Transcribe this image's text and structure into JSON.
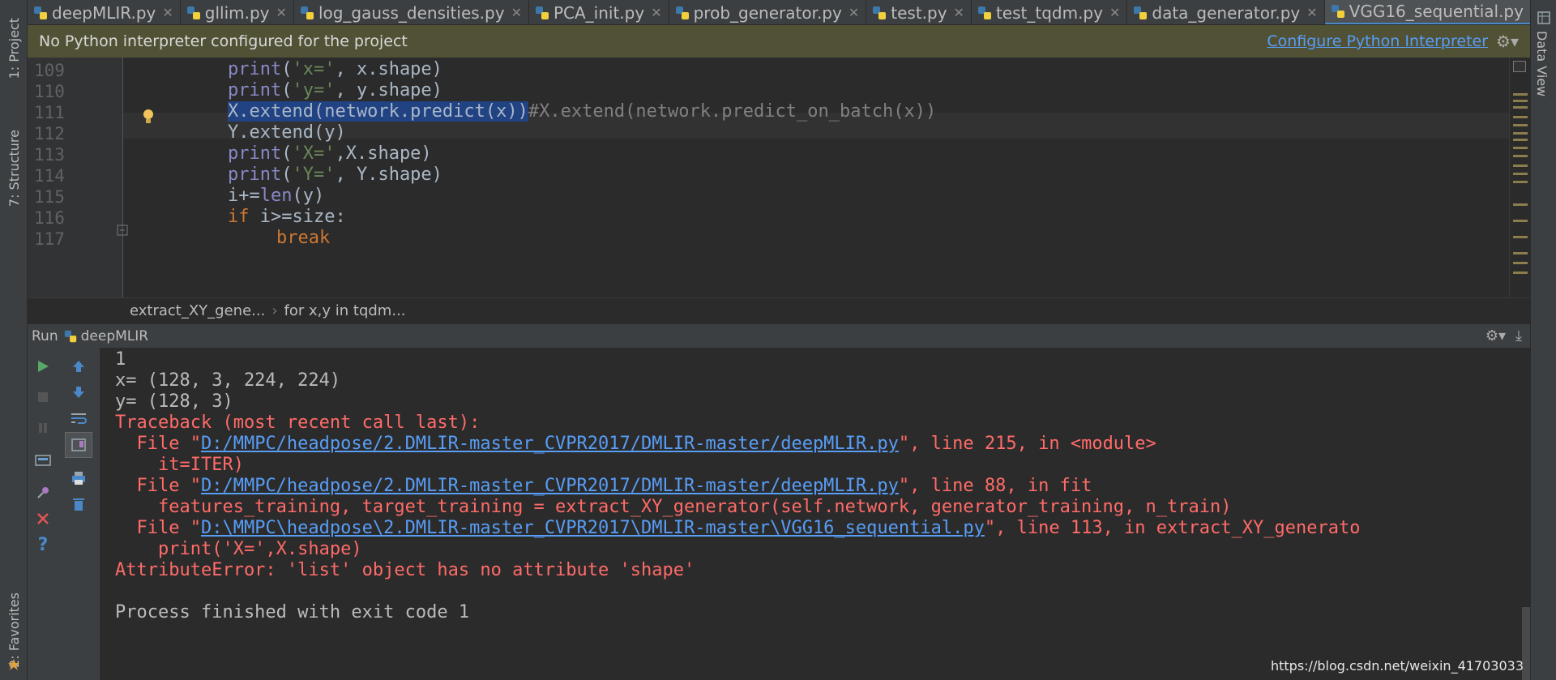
{
  "tabs": [
    {
      "label": "deepMLIR.py"
    },
    {
      "label": "gllim.py"
    },
    {
      "label": "log_gauss_densities.py"
    },
    {
      "label": "PCA_init.py"
    },
    {
      "label": "prob_generator.py"
    },
    {
      "label": "test.py"
    },
    {
      "label": "test_tqdm.py"
    },
    {
      "label": "data_generator.py"
    },
    {
      "label": "VGG16_sequential.py"
    }
  ],
  "side": {
    "project": "1: Project",
    "structure": "7: Structure",
    "favorites": "2: Favorites",
    "data_view": "Data View"
  },
  "notification": {
    "message": "No Python interpreter configured for the project",
    "link": "Configure Python Interpreter"
  },
  "editor": {
    "lines": [
      {
        "num": "109"
      },
      {
        "num": "110"
      },
      {
        "num": "111"
      },
      {
        "num": "112"
      },
      {
        "num": "113"
      },
      {
        "num": "114"
      },
      {
        "num": "115"
      },
      {
        "num": "116"
      },
      {
        "num": "117"
      }
    ]
  },
  "breadcrumb": {
    "item1": "extract_XY_gene...",
    "item2": "for x,y in tqdm..."
  },
  "run": {
    "label": "Run",
    "config": "deepMLIR"
  },
  "console": {
    "l1": "1",
    "l2": "x= (128, 3, 224, 224)",
    "l3": "y= (128, 3)",
    "l4": "Traceback (most recent call last):",
    "l5_pre": "  File \"",
    "l5_link": "D:/MMPC/headpose/2.DMLIR-master_CVPR2017/DMLIR-master/deepMLIR.py",
    "l5_post": "\", line 215, in <module>",
    "l6": "    it=ITER)",
    "l7_pre": "  File \"",
    "l7_link": "D:/MMPC/headpose/2.DMLIR-master_CVPR2017/DMLIR-master/deepMLIR.py",
    "l7_post": "\", line 88, in fit",
    "l8": "    features_training, target_training = extract_XY_generator(self.network, generator_training, n_train)",
    "l9_pre": "  File \"",
    "l9_link": "D:\\MMPC\\headpose\\2.DMLIR-master_CVPR2017\\DMLIR-master\\VGG16_sequential.py",
    "l9_post": "\", line 113, in extract_XY_generato",
    "l10": "    print('X=',X.shape)",
    "l11": "AttributeError: 'list' object has no attribute 'shape'",
    "l12": "Process finished with exit code 1"
  },
  "watermark": "https://blog.csdn.net/weixin_41703033"
}
